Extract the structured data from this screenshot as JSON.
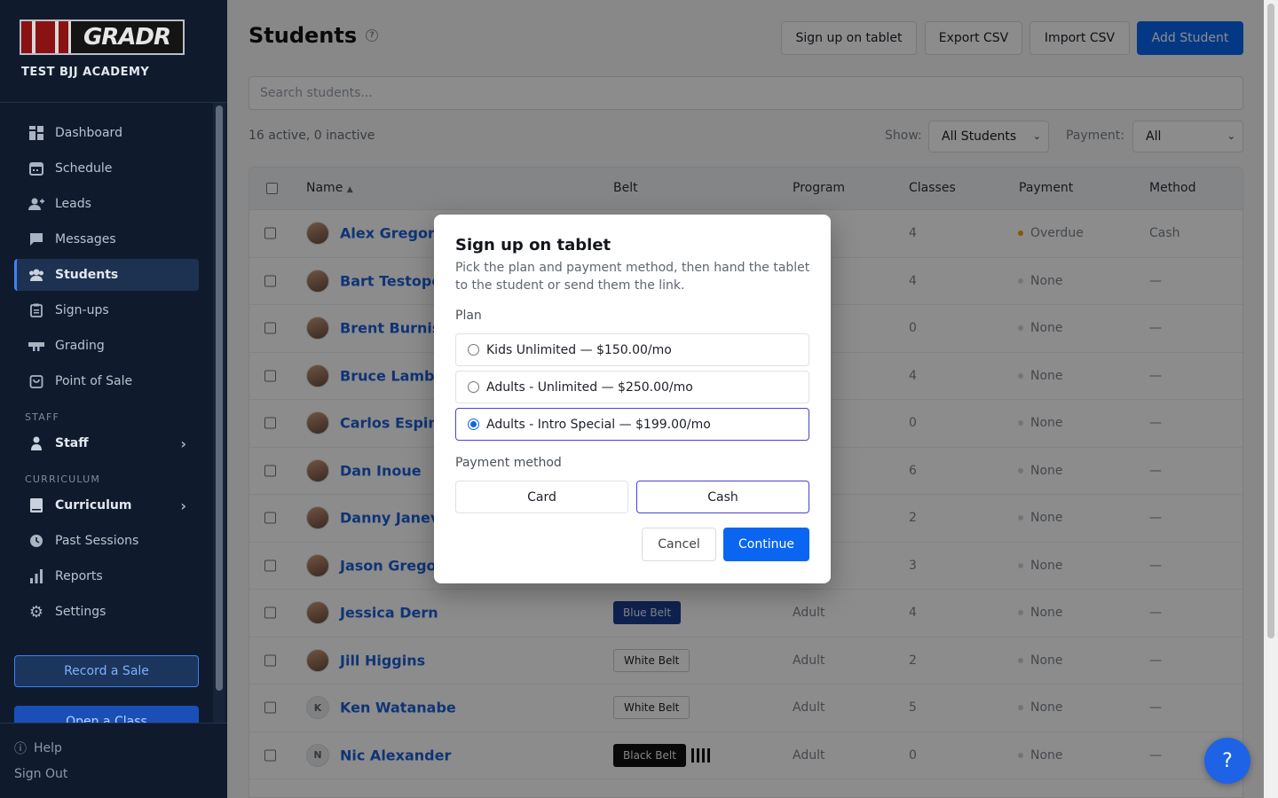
{
  "brand": {
    "logo_text": "GRADR",
    "academy": "TEST BJJ ACADEMY"
  },
  "sidebar": {
    "items": [
      {
        "label": "Dashboard",
        "icon": "grid-icon"
      },
      {
        "label": "Schedule",
        "icon": "calendar-icon"
      },
      {
        "label": "Leads",
        "icon": "user-plus-icon"
      },
      {
        "label": "Messages",
        "icon": "chat-icon"
      },
      {
        "label": "Students",
        "icon": "users-icon",
        "active": true
      },
      {
        "label": "Sign-ups",
        "icon": "clipboard-icon"
      },
      {
        "label": "Grading",
        "icon": "belt-icon"
      },
      {
        "label": "Point of Sale",
        "icon": "bag-icon"
      }
    ],
    "staff_section": "STAFF",
    "staff_item": "Staff",
    "curriculum_section": "CURRICULUM",
    "curriculum_item": "Curriculum",
    "more_items": [
      {
        "label": "Past Sessions",
        "icon": "clock-icon"
      },
      {
        "label": "Reports",
        "icon": "bar-chart-icon"
      },
      {
        "label": "Settings",
        "icon": "gear-icon"
      }
    ],
    "record_sale": "Record a Sale",
    "open_class": "Open a Class",
    "help": "Help",
    "sign_out": "Sign Out"
  },
  "header": {
    "title": "Students",
    "buttons": {
      "tablet": "Sign up on tablet",
      "export": "Export CSV",
      "import": "Import CSV",
      "add": "Add Student"
    }
  },
  "search": {
    "placeholder": "Search students..."
  },
  "filters": {
    "counts": "16 active, 0 inactive",
    "show_label": "Show:",
    "show_value": "All Students",
    "payment_label": "Payment:",
    "payment_value": "All"
  },
  "table": {
    "columns": {
      "name": "Name",
      "sort": "▲",
      "belt": "Belt",
      "program": "Program",
      "classes": "Classes",
      "payment": "Payment",
      "method": "Method"
    },
    "rows": [
      {
        "name": "Alex Gregorio",
        "belt": "",
        "program": "",
        "classes": "4",
        "payment": "Overdue",
        "method": "Cash"
      },
      {
        "name": "Bart Testopolis",
        "belt": "",
        "program": "",
        "classes": "4",
        "payment": "None",
        "method": "—"
      },
      {
        "name": "Brent Burniston",
        "belt": "",
        "program": "",
        "classes": "0",
        "payment": "None",
        "method": "—"
      },
      {
        "name": "Bruce Lambert",
        "belt": "",
        "program": "",
        "classes": "4",
        "payment": "None",
        "method": "—"
      },
      {
        "name": "Carlos Espinoza",
        "belt": "",
        "program": "",
        "classes": "0",
        "payment": "None",
        "method": "—"
      },
      {
        "name": "Dan Inoue",
        "belt": "",
        "program": "",
        "classes": "6",
        "payment": "None",
        "method": "—"
      },
      {
        "name": "Danny Janev",
        "belt": "",
        "program": "",
        "classes": "2",
        "payment": "None",
        "method": "—"
      },
      {
        "name": "Jason Gregorio",
        "belt": "",
        "program": "",
        "classes": "3",
        "payment": "None",
        "method": "—"
      },
      {
        "name": "Jessica Dern",
        "belt": "Blue Belt",
        "program": "Adult",
        "classes": "4",
        "payment": "None",
        "method": "—"
      },
      {
        "name": "Jill Higgins",
        "belt": "White Belt",
        "program": "Adult",
        "classes": "2",
        "payment": "None",
        "method": "—"
      },
      {
        "name": "Ken Watanabe",
        "initial": "K",
        "belt": "White Belt",
        "program": "Adult",
        "classes": "5",
        "payment": "None",
        "method": "—"
      },
      {
        "name": "Nic Alexander",
        "initial": "N",
        "belt": "Black Belt",
        "program": "Adult",
        "classes": "0",
        "payment": "None",
        "method": "—"
      }
    ]
  },
  "modal": {
    "title": "Sign up on tablet",
    "description": "Pick the plan and payment method, then hand the tablet to the student or send them the link.",
    "plan_label": "Plan",
    "plans": [
      "Kids Unlimited — $150.00/mo",
      "Adults - Unlimited — $250.00/mo",
      "Adults - Intro Special — $199.00/mo"
    ],
    "selected_plan": 2,
    "payment_label": "Payment method",
    "payment_card": "Card",
    "payment_cash": "Cash",
    "selected_payment": "Cash",
    "cancel": "Cancel",
    "continue": "Continue"
  },
  "help_fab": "?",
  "colors": {
    "primary": "#0a66f0",
    "sidebar": "#0f1b2d",
    "selection": "#4a3fd6",
    "overdue": "#f0a300"
  }
}
